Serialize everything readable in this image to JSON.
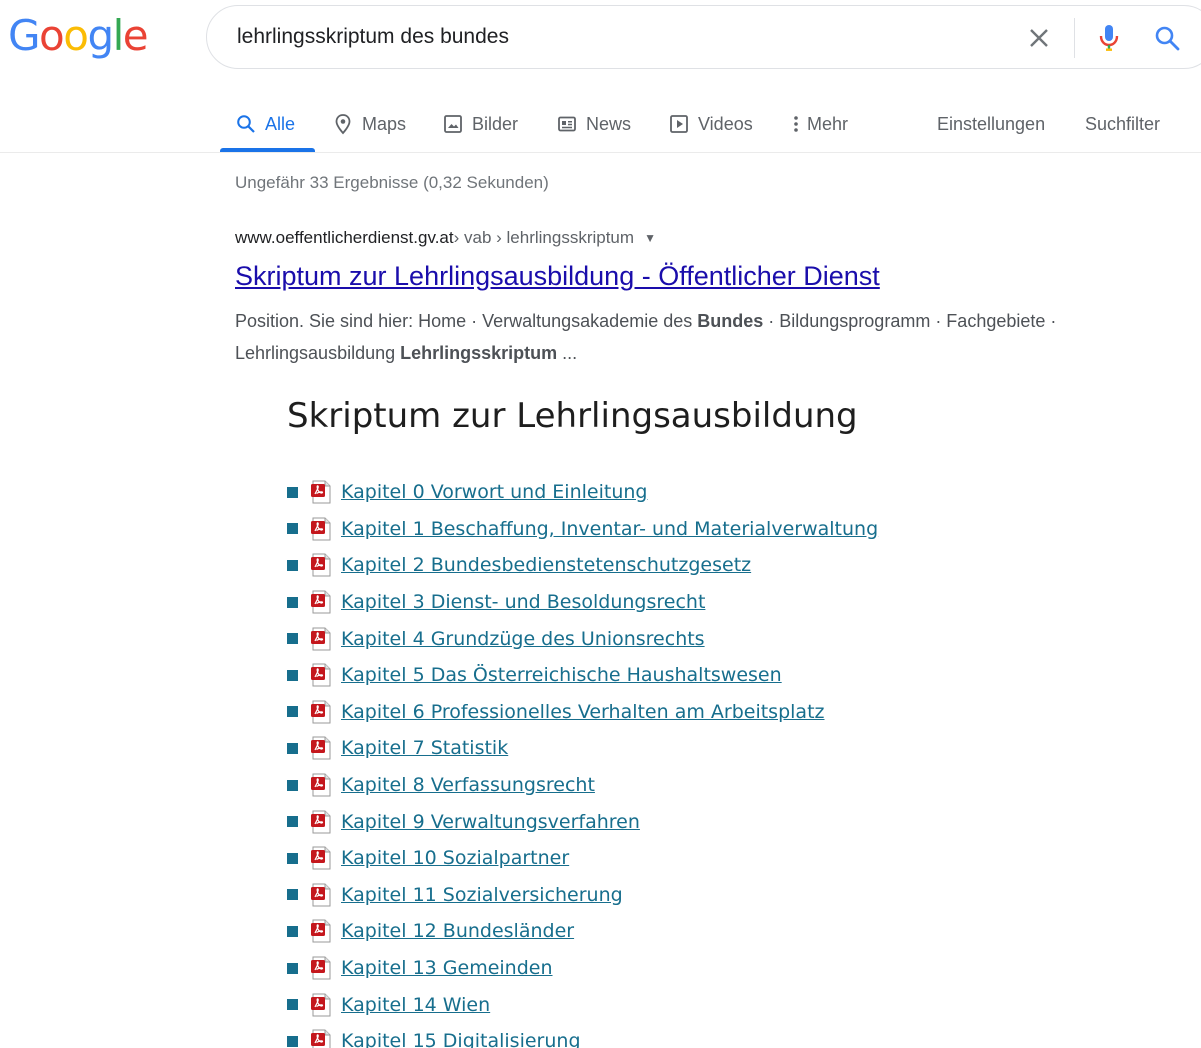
{
  "logo": {
    "letters": [
      "G",
      "o",
      "o",
      "g",
      "l",
      "e"
    ],
    "colors": [
      "#4285F4",
      "#EA4335",
      "#FBBC05",
      "#4285F4",
      "#34A853",
      "#EA4335"
    ]
  },
  "search": {
    "query": "lehrlingsskriptum des bundes",
    "icons": [
      "close-icon",
      "microphone-icon",
      "search-icon"
    ]
  },
  "nav": {
    "tabs": [
      {
        "label": "Alle",
        "icon": "search-icon",
        "active": true
      },
      {
        "label": "Maps",
        "icon": "map-pin-icon"
      },
      {
        "label": "Bilder",
        "icon": "image-icon"
      },
      {
        "label": "News",
        "icon": "newspaper-icon"
      },
      {
        "label": "Videos",
        "icon": "play-icon"
      },
      {
        "label": "Mehr",
        "icon": "more-vert-icon"
      }
    ],
    "settings": "Einstellungen",
    "tools": "Suchfilter"
  },
  "results": {
    "stats": "Ungefähr 33 Ergebnisse (0,32 Sekunden)",
    "items": [
      {
        "domain": "www.oeffentlicherdienst.gv.at",
        "path": " › vab › lehrlingsskriptum",
        "title": "Skriptum zur Lehrlingsausbildung - Öffentlicher Dienst",
        "snippet": {
          "p1": "Position. Sie sind hier: Home · Verwaltungsakademie des ",
          "b1": "Bundes",
          "p2": " · Bildungsprogramm · Fachgebiete · Lehrlingsausbildung ",
          "b2": "Lehrlingsskriptum",
          "p3": " ..."
        }
      }
    ]
  },
  "embedded": {
    "title": "Skriptum zur Lehrlingsausbildung",
    "chapters": [
      "Kapitel 0 Vorwort und Einleitung",
      "Kapitel 1 Beschaffung, Inventar- und Materialverwaltung",
      "Kapitel 2 Bundesbedienstetenschutzgesetz",
      "Kapitel 3 Dienst- und Besoldungsrecht",
      "Kapitel 4 Grundzüge des Unionsrechts ",
      "Kapitel 5 Das Österreichische Haushaltswesen",
      "Kapitel 6 Professionelles Verhalten am Arbeitsplatz ",
      "Kapitel 7 Statistik",
      "Kapitel 8 Verfassungsrecht",
      "Kapitel 9 Verwaltungsverfahren",
      "Kapitel 10 Sozialpartner",
      "Kapitel 11 Sozialversicherung",
      "Kapitel 12 Bundesländer",
      "Kapitel 13 Gemeinden",
      "Kapitel 14 Wien",
      "Kapitel 15  Digitalisierung"
    ]
  }
}
